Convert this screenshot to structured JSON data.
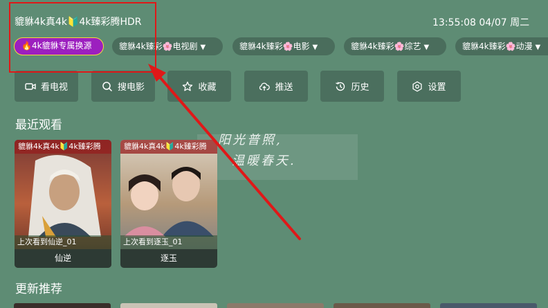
{
  "header": {
    "source_title": "貔貅4k真4k🔰4k臻彩腾HDR",
    "clock": "13:55:08 04/07 周二"
  },
  "chips": [
    {
      "label": "🔥4k貔貅专属换源",
      "special": true,
      "filter": false
    },
    {
      "label": "貔貅4k臻彩🌸电视剧",
      "special": false,
      "filter": true
    },
    {
      "label": "貔貅4k臻彩🌸电影",
      "special": false,
      "filter": true
    },
    {
      "label": "貔貅4k臻彩🌸综艺",
      "special": false,
      "filter": true
    },
    {
      "label": "貔貅4k臻彩🌸动漫",
      "special": false,
      "filter": true
    }
  ],
  "filter_glyph": "▼",
  "buttons": [
    {
      "label": "看电视",
      "icon": "tv-camera-icon"
    },
    {
      "label": "搜电影",
      "icon": "search-icon"
    },
    {
      "label": "收藏",
      "icon": "star-icon"
    },
    {
      "label": "推送",
      "icon": "cloud-upload-icon"
    },
    {
      "label": "历史",
      "icon": "history-icon"
    },
    {
      "label": "设置",
      "icon": "settings-icon"
    }
  ],
  "recent_section": {
    "title": "最近观看"
  },
  "recent": [
    {
      "tag": "貔貅4k真4k🔰4k臻彩腾",
      "progress": "上次看到仙逆_01",
      "title": "仙逆"
    },
    {
      "tag": "貔貅4k真4k🔰4k臻彩腾",
      "progress": "上次看到逐玉_01",
      "title": "逐玉"
    }
  ],
  "watermark": {
    "line1": "阳光普照,",
    "line2": "温暖春天."
  },
  "update_section": {
    "title": "更新推荐"
  },
  "colors": {
    "background": "#5e8c74",
    "chip": "#4a6d5c",
    "special_chip": "#9c1fbf",
    "annotation": "#e01818"
  }
}
